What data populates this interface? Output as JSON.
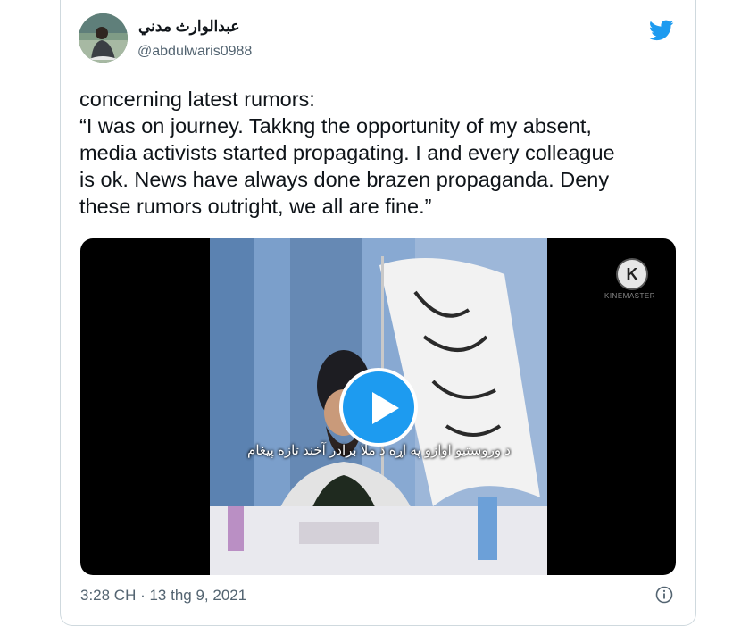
{
  "author": {
    "name": "عبدالوارث مدني",
    "handle": "@abdulwaris0988"
  },
  "tweet": {
    "lines": [
      "concerning latest rumors:",
      "“I was on journey. Takkng the opportunity of my absent,",
      "media activists started propagating. I and every colleague",
      "is ok. News have always done brazen propaganda. Deny",
      "these rumors outright, we all are fine.”"
    ]
  },
  "video": {
    "subtitle": "د وروستيو اوازو په اړه د ملا برادر آخند تازه پيغام",
    "watermark_letter": "K",
    "watermark_text": "KINEMASTER"
  },
  "footer": {
    "timestamp": "3:28 CH · 13 thg 9, 2021"
  },
  "colors": {
    "accent": "#1d9bf0",
    "secondary_text": "#536471",
    "border": "#cfd9de"
  },
  "icons": {
    "logo": "twitter-bird-icon",
    "play": "play-icon",
    "info": "info-icon"
  }
}
